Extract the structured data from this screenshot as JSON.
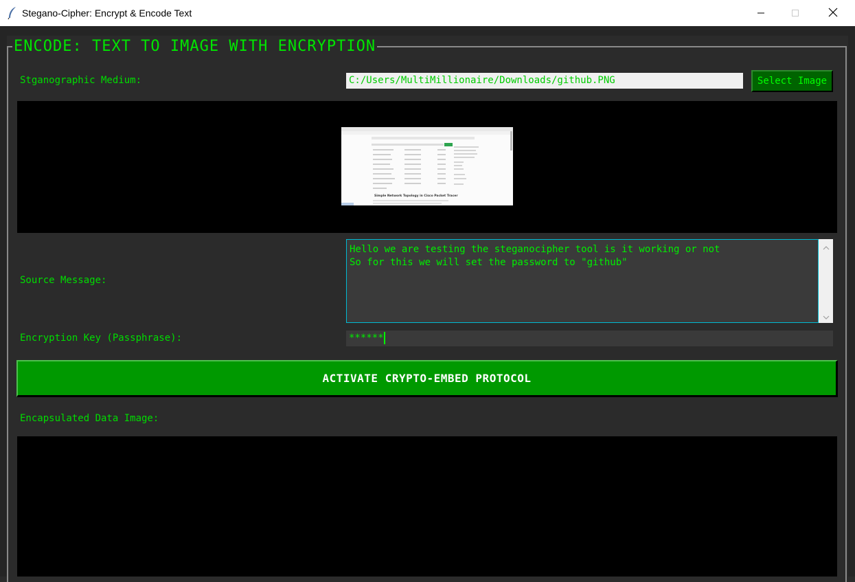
{
  "window": {
    "title": "Stegano-Cipher: Encrypt & Encode Text",
    "app_icon": "feather-icon"
  },
  "group": {
    "title": "ENCODE: TEXT TO IMAGE WITH ENCRYPTION"
  },
  "medium": {
    "label": "Stganographic Medium:",
    "path": "C:/Users/MultiMillionaire/Downloads/github.PNG",
    "button_label": "Select Image"
  },
  "preview": {
    "heading": "Simple Network Topology in Cisco Packet Tracer"
  },
  "message": {
    "label": "Source Message:",
    "text": "Hello we are testing the steganocipher tool is it working or not\nSo for this we will set the password to \"github\""
  },
  "key": {
    "label": "Encryption Key (Passphrase):",
    "value": "******"
  },
  "action": {
    "label": "ACTIVATE CRYPTO-EMBED PROTOCOL"
  },
  "output": {
    "label": "Encapsulated Data Image:"
  },
  "colors": {
    "background": "#2b2b2b",
    "accent_green": "#00dd00",
    "button_green": "#009900",
    "select_button": "#006400",
    "focus_border": "#00bcd4"
  }
}
